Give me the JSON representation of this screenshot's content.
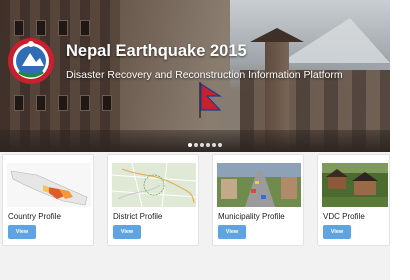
{
  "hero": {
    "title": "Nepal Earthquake 2015",
    "subtitle": "Disaster Recovery and Reconstruction Information Platform",
    "logo_icon": "nepal-emblem-icon",
    "slides": 6,
    "active_slide": 0
  },
  "cards": [
    {
      "label": "Country Profile",
      "button": "View",
      "thumbnail_icon": "country-map-thumbnail"
    },
    {
      "label": "District Profile",
      "button": "View",
      "thumbnail_icon": "district-map-thumbnail"
    },
    {
      "label": "Municipality Profile",
      "button": "View",
      "thumbnail_icon": "municipality-photo-thumbnail"
    },
    {
      "label": "VDC Profile",
      "button": "View",
      "thumbnail_icon": "vdc-photo-thumbnail"
    }
  ],
  "colors": {
    "button_bg": "#5fa4e2",
    "hero_text": "#ffffff",
    "cards_bg": "#f2f2f2"
  }
}
